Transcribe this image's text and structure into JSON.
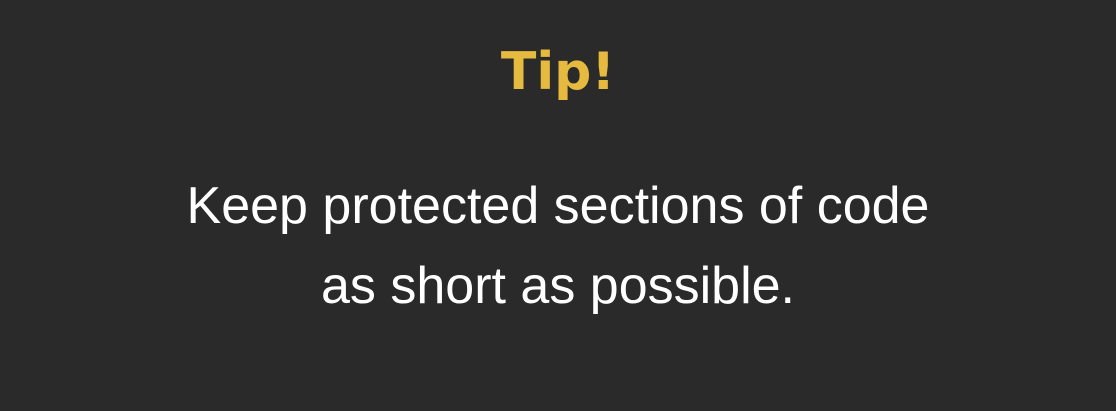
{
  "slide": {
    "title": "Tip!",
    "body_lines": [
      "Keep protected sections of code",
      "as short as possible."
    ]
  },
  "colors": {
    "background": "#2a2a2a",
    "title": "#e6b93f",
    "body": "#ffffff"
  }
}
